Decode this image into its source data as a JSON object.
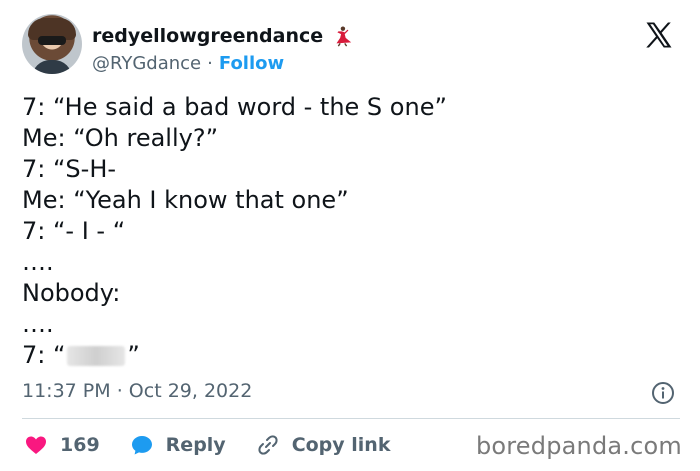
{
  "author": {
    "display_name": "redyellowgreendance",
    "handle": "@RYGdance",
    "separator": "·",
    "follow_label": "Follow"
  },
  "tweet": {
    "lines": [
      "7: “He said a bad word - the S one”",
      "Me: “Oh really?”",
      "7: “S-H-",
      "Me: “Yeah I know that one”",
      "7: “- I - “",
      "….",
      "Nobody:",
      "….",
      "7: “"
    ],
    "last_line_suffix": "”",
    "time": "11:37 PM",
    "meta_separator": "·",
    "date": "Oct 29, 2022"
  },
  "actions": {
    "like_count": "169",
    "reply_label": "Reply",
    "copy_link_label": "Copy link"
  },
  "watermark": "boredpanda.com",
  "colors": {
    "like": "#f91880",
    "reply": "#1d9bf0",
    "follow": "#1d9bf0",
    "secondary_text": "#536471"
  }
}
